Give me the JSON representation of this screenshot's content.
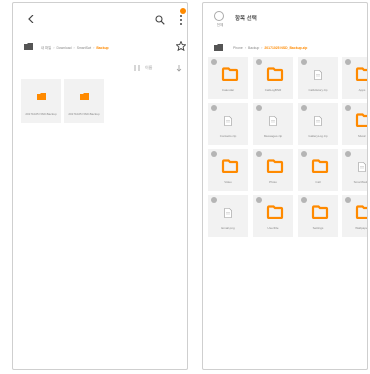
{
  "left_screen": {
    "path": {
      "segments": [
        "내 파일",
        "Download",
        "SmartSwi",
        "Backup"
      ],
      "current_index": 3
    },
    "sort_label": "이름",
    "tiles": [
      {
        "label": "20171025 NSD.Backup"
      },
      {
        "label": "20171025 NSD.Backup"
      }
    ]
  },
  "right_screen": {
    "select_all_label": "전체",
    "title": "항목 선택",
    "path": {
      "segments": [
        "Phone",
        "Backup",
        "20171025 NSD_Backup.zip"
      ],
      "current_index": 2
    },
    "items": [
      {
        "type": "folder",
        "label": "Calendar"
      },
      {
        "type": "folder",
        "label": "CallLogBNR"
      },
      {
        "type": "file",
        "label": "CallHistory.zip"
      },
      {
        "type": "folder",
        "label": "Apps"
      },
      {
        "type": "file",
        "label": "Contacts.zip"
      },
      {
        "type": "file",
        "label": "Messages.zip"
      },
      {
        "type": "file",
        "label": "GalleryLog.zip"
      },
      {
        "type": "folder",
        "label": "Music"
      },
      {
        "type": "folder",
        "label": "Video"
      },
      {
        "type": "folder",
        "label": "Photo"
      },
      {
        "type": "folder",
        "label": "Call"
      },
      {
        "type": "file",
        "label": "SmartSwitch"
      },
      {
        "type": "file",
        "label": "Email.png"
      },
      {
        "type": "folder",
        "label": "UserFile"
      },
      {
        "type": "folder",
        "label": "Settings"
      },
      {
        "type": "folder",
        "label": "Wallpaper"
      }
    ]
  },
  "colors": {
    "accent": "#ff8a00",
    "tile_bg": "#f2f2f2",
    "selection_circle": "#b5b5b5"
  },
  "icons": [
    "back-icon",
    "search-icon",
    "more-icon",
    "folder-icon",
    "star-icon",
    "sort-icon",
    "view-icon",
    "file-icon"
  ]
}
